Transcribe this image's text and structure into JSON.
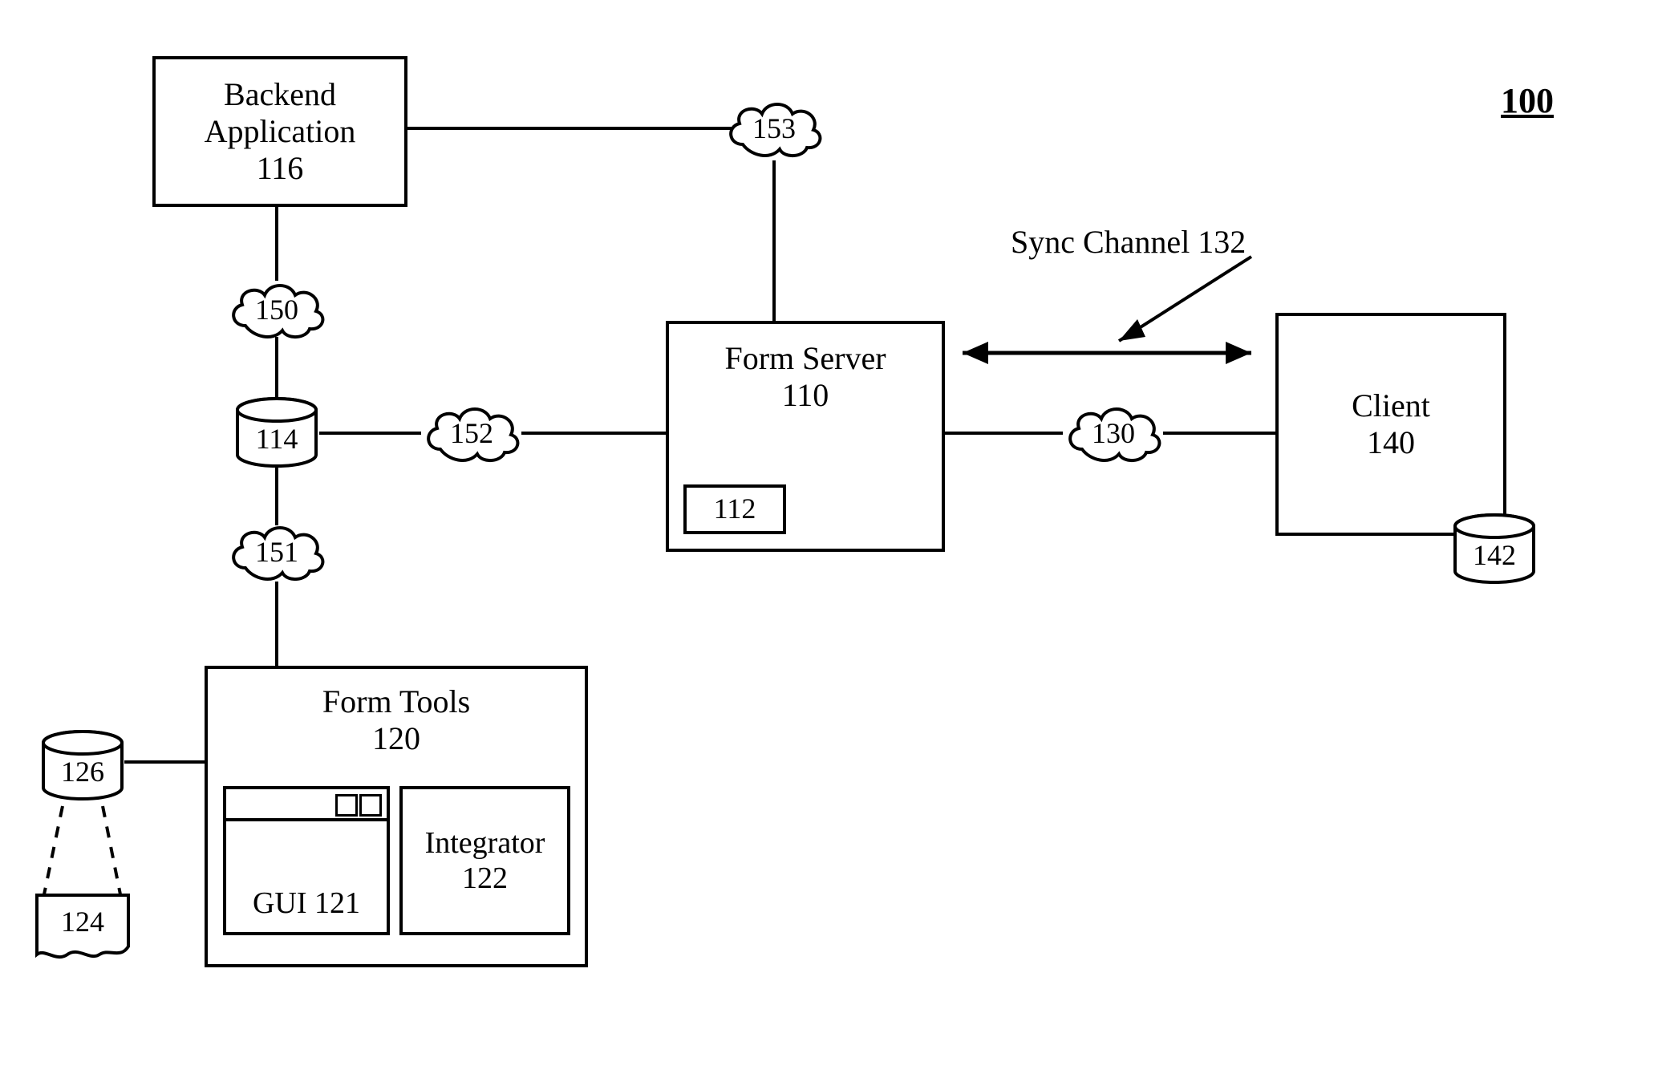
{
  "figure_label": "100",
  "backend_application": {
    "title": "Backend\nApplication",
    "num": "116"
  },
  "form_server": {
    "title": "Form Server",
    "num": "110",
    "inner": "112"
  },
  "client": {
    "title": "Client",
    "num": "140"
  },
  "form_tools": {
    "title": "Form Tools",
    "num": "120"
  },
  "integrator": {
    "title": "Integrator",
    "num": "122"
  },
  "gui_window": {
    "label": "GUI 121"
  },
  "cylinders": {
    "c114": "114",
    "c126": "126",
    "c142": "142"
  },
  "clouds": {
    "c150": "150",
    "c151": "151",
    "c152": "152",
    "c153": "153",
    "c130": "130"
  },
  "page": {
    "label": "124"
  },
  "sync_channel": "Sync Channel 132"
}
